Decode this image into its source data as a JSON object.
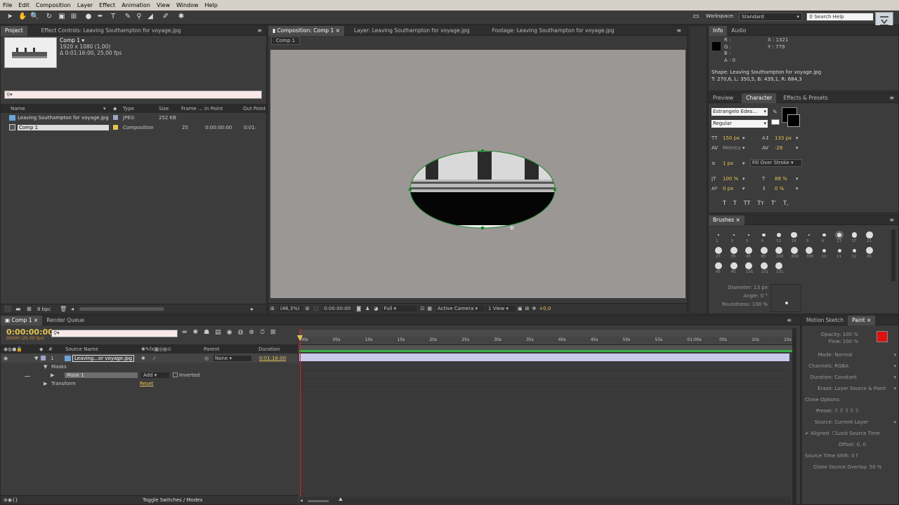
{
  "menu": [
    "File",
    "Edit",
    "Composition",
    "Layer",
    "Effect",
    "Animation",
    "View",
    "Window",
    "Help"
  ],
  "workspace": {
    "label": "Workspace:",
    "value": "Standard",
    "search_placeholder": "Search Help"
  },
  "project": {
    "tab_project": "Project",
    "tab_effect": "Effect Controls: Leaving Southampton for voyage.jpg",
    "comp_name": "Comp 1 ▾",
    "comp_res": "1920 x 1080 (1,00)",
    "comp_dur": "Δ 0:01:16:00, 25,00 fps",
    "search_placeholder": "",
    "headers": [
      "Name",
      "Type",
      "Size",
      "Frame ...",
      "In Point",
      "Out Point"
    ],
    "items": [
      {
        "name": "Leaving Southampton for voyage.jpg",
        "type": "JPEG",
        "size": "252 KB",
        "frame": "",
        "in": "",
        "out": ""
      },
      {
        "name": "Comp 1",
        "type": "Composition",
        "size": "",
        "frame": "25",
        "in": "0:00:00:00",
        "out": "0:01:"
      }
    ],
    "bpc": "8 bpc"
  },
  "viewer": {
    "tabs": [
      "Composition: Comp 1",
      "Layer: Leaving Southampton for voyage.jpg",
      "Footage: Leaving Southampton for voyage.jpg"
    ],
    "breadcrumb": "Comp 1",
    "zoom": "(46,3%)",
    "time": "0:00:00:00",
    "res": "Full",
    "camera": "Active Camera",
    "view": "1 View",
    "exposure": "+0,0"
  },
  "info": {
    "tabs": [
      "Info",
      "Audio"
    ],
    "r": "R :",
    "g": "G :",
    "b": "B :",
    "a": "A : 0",
    "x": "X : 1321",
    "y": "Y : 779",
    "shape": "Shape: Leaving Southampton for voyage.jpg",
    "shape_coords": "T: 270,6, L: 350,5, B: 439,1, R: 684,3"
  },
  "character": {
    "tabs": [
      "Preview",
      "Character",
      "Effects & Presets"
    ],
    "font": "Estrangelo Edes...",
    "style": "Regular",
    "size": "150 px",
    "leading": "133 px",
    "kerning": "Metrics",
    "tracking": "-26",
    "stroke": "1 px",
    "stroke_mode": "Fill Over Stroke",
    "vscale": "100 %",
    "hscale": "88 %",
    "baseline": "0 px",
    "tsume": "0 %",
    "styles": [
      "T",
      "T",
      "TT",
      "Tт",
      "T'",
      "T,"
    ]
  },
  "brushes": {
    "tab": "Brushes",
    "row1": [
      "1",
      "3",
      "5",
      "9",
      "13",
      "19",
      "5",
      "9",
      "13",
      "17",
      "21"
    ],
    "row2": [
      "27",
      "35",
      "45",
      "65",
      "100",
      "200",
      "300",
      "11",
      "11",
      "11",
      "45"
    ],
    "row3": [
      "45",
      "45",
      "131",
      "131",
      "131"
    ],
    "diameter": "Diameter: 13 px",
    "angle": "Angle: 0 °",
    "roundness": "Roundness: 100 %"
  },
  "timeline": {
    "tabs": [
      "Comp 1",
      "Render Queue"
    ],
    "time": "0:00:00:00",
    "fps": "00000 (25.00 fps)",
    "headers": {
      "source": "Source Name",
      "parent": "Parent",
      "duration": "Duration"
    },
    "layer": {
      "num": "1",
      "name": "Leaving...or voyage.jpg",
      "parent": "None",
      "duration": "0:01:16:00"
    },
    "masks": "Masks",
    "mask1": "Mask 1",
    "add": "Add",
    "inverted": "Inverted",
    "transform": "Transform",
    "reset": "Reset",
    "ruler": [
      "00s",
      "05s",
      "10s",
      "15s",
      "20s",
      "25s",
      "30s",
      "35s",
      "40s",
      "45s",
      "50s",
      "55s",
      "01:00s",
      "05s",
      "10s",
      "15s"
    ],
    "toggle": "Toggle Switches / Modes"
  },
  "paint": {
    "tabs": [
      "Motion Sketch",
      "Paint"
    ],
    "opacity": "Opacity: 100 %",
    "flow": "Flow: 100 %",
    "mode_label": "Mode:",
    "mode": "Normal",
    "channels_label": "Channels:",
    "channels": "RGBA",
    "duration_label": "Duration:",
    "duration": "Constant",
    "erase_label": "Erase:",
    "erase": "Layer Source & Paint",
    "clone_options": "Clone Options",
    "preset": "Preset:",
    "source_label": "Source:",
    "source": "Current Layer",
    "aligned": "Aligned",
    "lock": "Lock Source Time",
    "offset": "Offset: 0,    0",
    "shift": "Source Time Shift: 0 f",
    "overlay": "Clone Source Overlay: 50 %",
    "color": "#e01010"
  },
  "colors": {
    "accent": "#e5c252",
    "selection": "#9fa3c9",
    "bar": "#c9c9ec"
  }
}
